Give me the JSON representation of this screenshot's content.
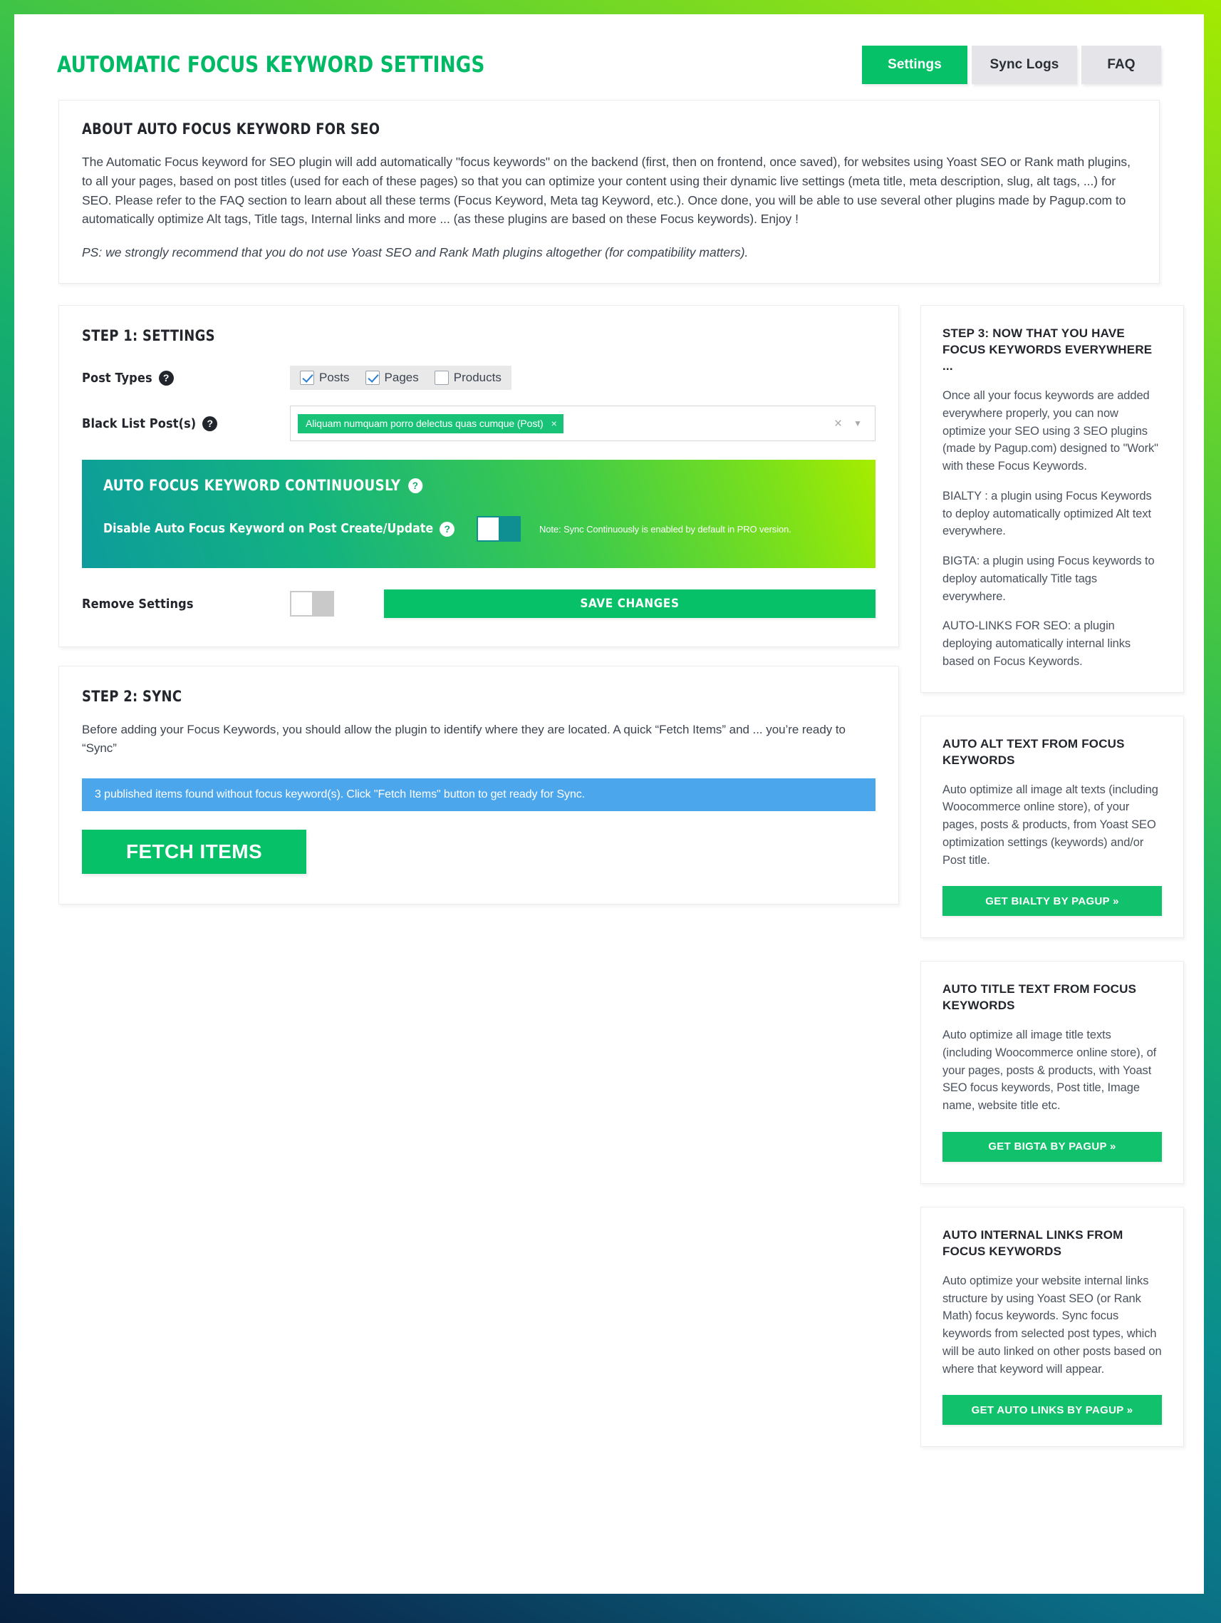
{
  "header": {
    "title": "AUTOMATIC FOCUS KEYWORD SETTINGS",
    "tabs": [
      {
        "label": "Settings",
        "active": true
      },
      {
        "label": "Sync Logs",
        "active": false
      },
      {
        "label": "FAQ",
        "active": false
      }
    ]
  },
  "about": {
    "heading": "ABOUT AUTO FOCUS KEYWORD FOR SEO",
    "body": "The Automatic Focus keyword for SEO plugin will add automatically \"focus keywords\" on the backend (first, then on frontend, once saved), for websites using Yoast SEO or Rank math plugins, to all your pages, based on post titles (used for each of these pages) so that you can optimize your content using their dynamic live settings (meta title, meta description, slug, alt tags, ...) for SEO. Please refer to the FAQ section to learn about all these terms (Focus Keyword, Meta tag Keyword, etc.). Once done, you will be able to use several other plugins made by Pagup.com to automatically optimize Alt tags, Title tags, Internal links and more ... (as these plugins are based on these Focus keywords). Enjoy !",
    "ps": "PS: we strongly recommend that you do not use Yoast SEO and Rank Math plugins altogether (for compatibility matters)."
  },
  "step1": {
    "heading": "STEP 1: SETTINGS",
    "post_types_label": "Post Types",
    "help_icon": "?",
    "post_types": [
      {
        "label": "Posts",
        "checked": true
      },
      {
        "label": "Pages",
        "checked": true
      },
      {
        "label": "Products",
        "checked": false
      }
    ],
    "blacklist_label": "Black List Post(s)",
    "blacklist_tokens": [
      {
        "label": "Aliquam numquam porro delectus quas cumque (Post)",
        "remove_icon": "×"
      }
    ],
    "select_clear_icon": "×",
    "select_caret_icon": "▼",
    "banner": {
      "title": "AUTO FOCUS KEYWORD CONTINUOUSLY",
      "toggle_label": "Disable Auto Focus Keyword on Post Create/Update",
      "note": "Note: Sync Continuously is enabled by default in PRO version.",
      "toggle_on": false
    },
    "remove_settings_label": "Remove Settings",
    "remove_settings_on": false,
    "save_label": "SAVE CHANGES"
  },
  "step2": {
    "heading": "STEP 2: SYNC",
    "description": "Before adding your Focus Keywords, you should allow the plugin to identify where they are located. A quick “Fetch Items” and ... you’re ready to “Sync”",
    "notice": "3 published items found without focus keyword(s). Click \"Fetch Items\" button to get ready for Sync.",
    "fetch_label": "FETCH ITEMS"
  },
  "sidebar": {
    "step3": {
      "title": "STEP 3: NOW THAT YOU HAVE FOCUS KEYWORDS EVERYWHERE ...",
      "p1": "Once all your focus keywords are added everywhere properly, you can now optimize your SEO using 3 SEO plugins (made by Pagup.com) designed to \"Work\" with these Focus Keywords.",
      "p2": "BIALTY : a plugin using Focus Keywords to deploy automatically optimized Alt text everywhere.",
      "p3": "BIGTA: a plugin using Focus keywords to deploy automatically Title tags everywhere.",
      "p4": "AUTO-LINKS FOR SEO: a plugin deploying automatically internal links based on Focus Keywords."
    },
    "cards": [
      {
        "title": "AUTO ALT TEXT FROM FOCUS KEYWORDS",
        "body": "Auto optimize all image alt texts (including Woocommerce online store), of your pages, posts & products, from Yoast SEO optimization settings (keywords) and/or Post title.",
        "button": "GET BIALTY BY PAGUP »"
      },
      {
        "title": "AUTO TITLE TEXT FROM FOCUS KEYWORDS",
        "body": "Auto optimize all image title texts (including Woocommerce online store), of your pages, posts & products, with Yoast SEO focus keywords, Post title, Image name, website title etc.",
        "button": "GET BIGTA BY PAGUP »"
      },
      {
        "title": "AUTO INTERNAL LINKS FROM FOCUS KEYWORDS",
        "body": "Auto optimize your website internal links structure by using Yoast SEO (or Rank Math) focus keywords. Sync focus keywords from selected post types, which will be auto linked on other posts based on where that keyword will appear.",
        "button": "GET AUTO LINKS BY PAGUP »"
      }
    ]
  },
  "colors": {
    "accent_green": "#06c168",
    "notice_blue": "#4ca6eb",
    "token_green": "#18c377"
  }
}
